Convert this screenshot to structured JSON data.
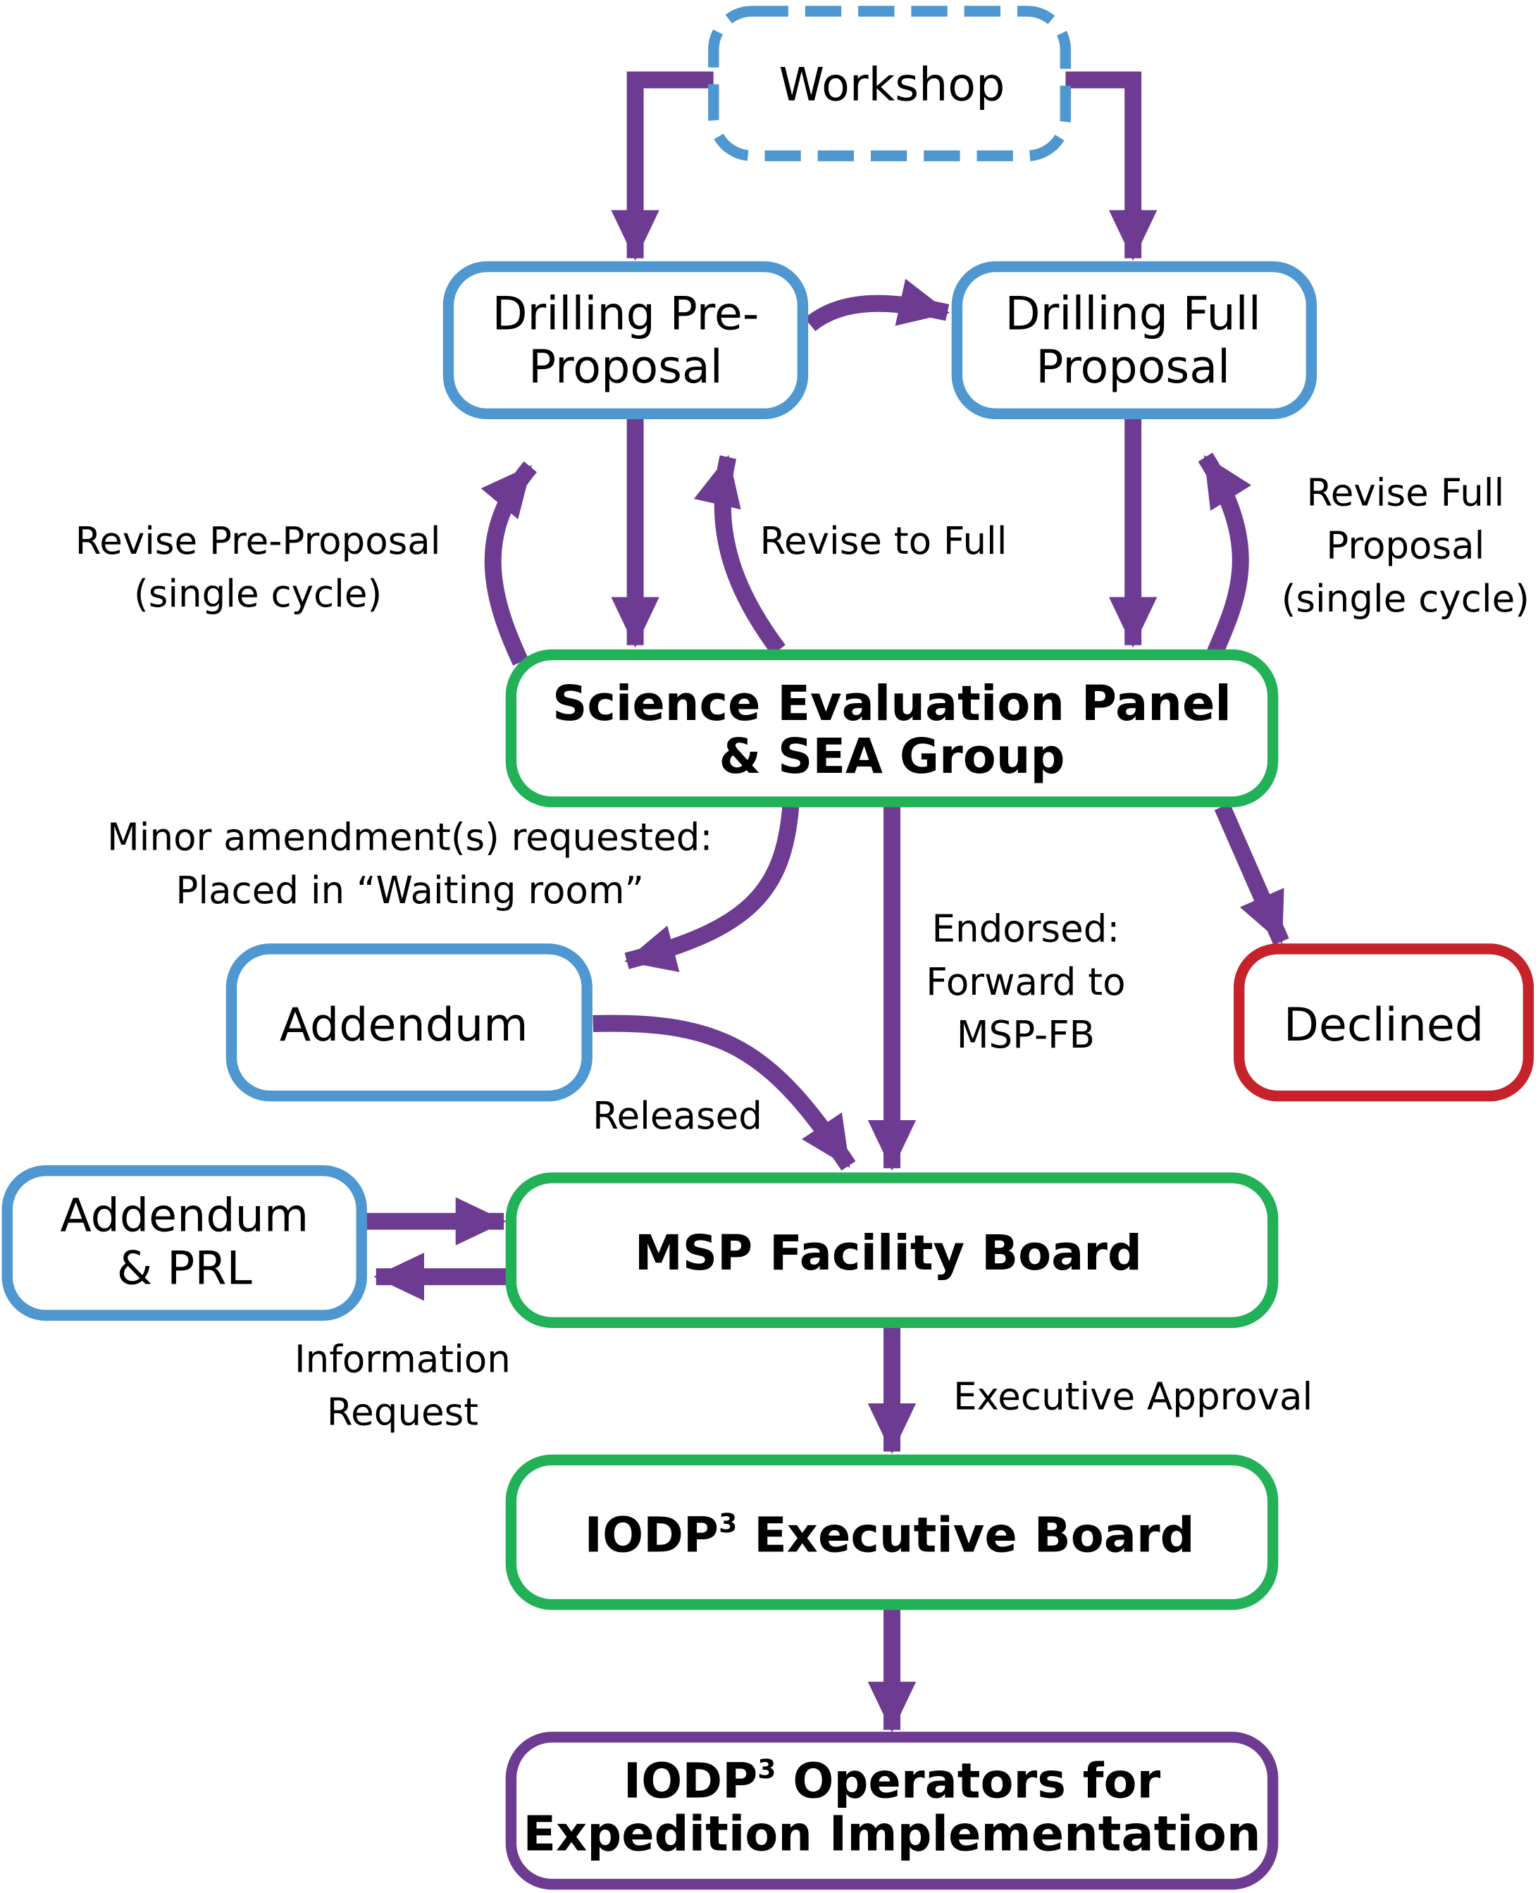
{
  "colors": {
    "arrow": "#6e3b93",
    "proposal_box": "#4e97d1",
    "panel_box": "#22b157",
    "declined_box": "#c62229",
    "operators_box": "#6e3b93"
  },
  "nodes": {
    "workshop": "Workshop",
    "pre_proposal": [
      "Drilling Pre-",
      "Proposal"
    ],
    "full_proposal": [
      "Drilling Full",
      "Proposal"
    ],
    "sep": [
      "Science Evaluation Panel",
      "& SEA Group"
    ],
    "addendum": "Addendum",
    "declined": "Declined",
    "addendum_prl": [
      "Addendum",
      "& PRL"
    ],
    "msp_fb": "MSP Facility Board",
    "exec_board": {
      "prefix": "IODP",
      "sup": "3",
      "suffix": " Executive Board"
    },
    "operators": {
      "prefix": "IODP",
      "sup": "3",
      "suffix": " Operators for",
      "line2": "Expedition Implementation"
    }
  },
  "labels": {
    "revise_pre": [
      "Revise Pre-Proposal",
      "(single cycle)"
    ],
    "revise_to_full": "Revise to Full",
    "revise_full": [
      "Revise Full",
      "Proposal",
      "(single cycle)"
    ],
    "minor_amendment": [
      "Minor amendment(s) requested:",
      "Placed in “Waiting room”"
    ],
    "endorsed": [
      "Endorsed:",
      "Forward to",
      "MSP-FB"
    ],
    "released": "Released",
    "information_request": [
      "Information",
      "Request"
    ],
    "executive_approval": "Executive Approval"
  }
}
